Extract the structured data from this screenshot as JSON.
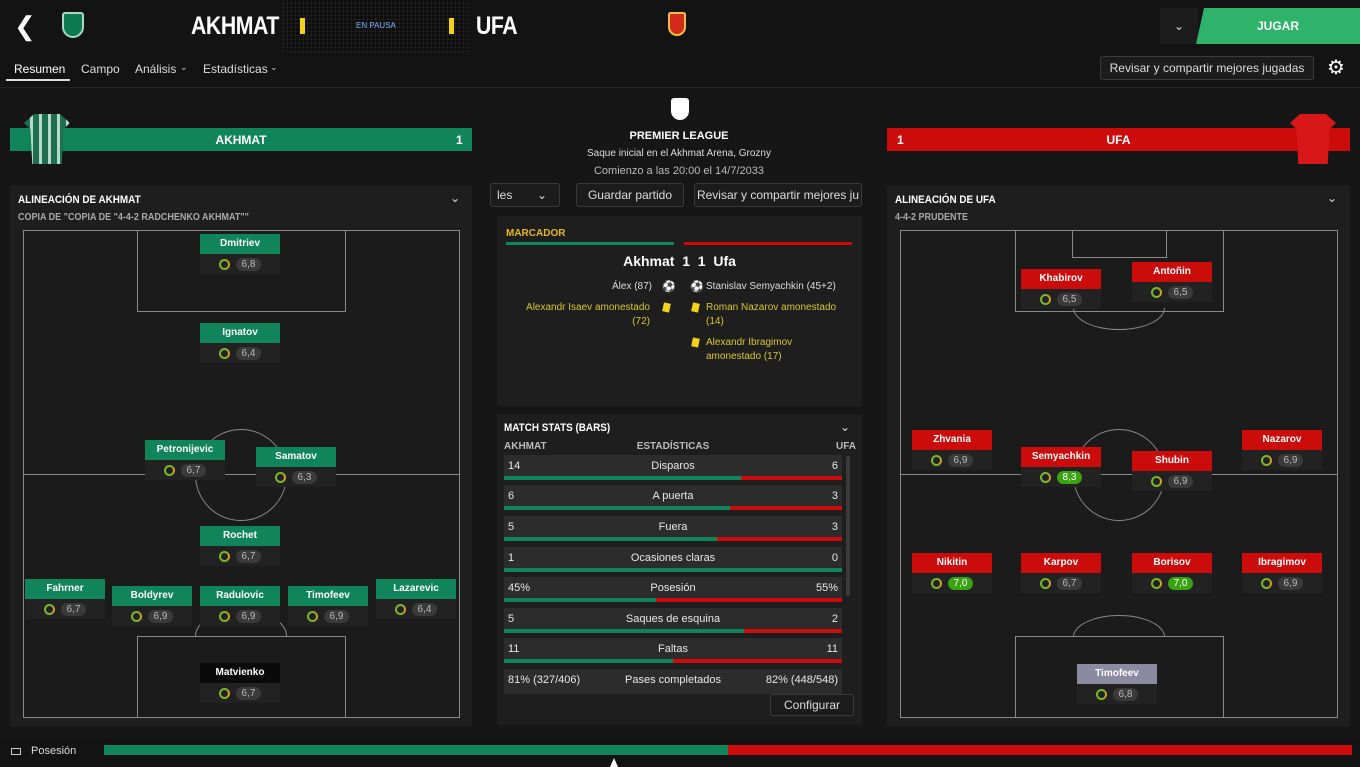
{
  "header": {
    "home_team": "AKHMAT",
    "away_team": "UFA",
    "status": "EN PAUSA",
    "play_label": "JUGAR"
  },
  "tabs": [
    {
      "label": "Resumen"
    },
    {
      "label": "Campo"
    },
    {
      "label": "Análisis"
    },
    {
      "label": "Estadísticas"
    }
  ],
  "review_button": "Revisar y compartir mejores jugadas",
  "home_banner": {
    "name": "AKHMAT",
    "score": "1"
  },
  "away_banner": {
    "name": "UFA",
    "score": "1"
  },
  "match_info": {
    "league": "PREMIER LEAGUE",
    "kickoff": "Saque inicial en el Akhmat Arena, Grozny",
    "time": "Comienzo a las 20:00 el 14/7/2033"
  },
  "mid_buttons": {
    "left": "les",
    "save": "Guardar partido",
    "review": "Revisar y compartir mejores ju"
  },
  "scoreboard": {
    "title": "MARCADOR",
    "line": "Akhmat  1  1  Ufa",
    "home_events": [
      {
        "text": "Álex (87)",
        "type": "goal"
      },
      {
        "text": "Alexandr Isaev amonestado (72)",
        "type": "yellow"
      }
    ],
    "away_events": [
      {
        "text": "Stanislav Semyachkin (45+2)",
        "type": "goal"
      },
      {
        "text": "Roman Nazarov amonestado (14)",
        "type": "yellow"
      },
      {
        "text": "Alexandr Ibragimov amonestado (17)",
        "type": "yellow"
      }
    ]
  },
  "stats": {
    "title": "MATCH STATS (BARS)",
    "home": "AKHMAT",
    "mid": "ESTADÍSTICAS",
    "away": "UFA",
    "configure": "Configurar",
    "rows": [
      {
        "label": "Disparos",
        "home": "14",
        "away": "6",
        "home_share": 0.7
      },
      {
        "label": "A puerta",
        "home": "6",
        "away": "3",
        "home_share": 0.67
      },
      {
        "label": "Fuera",
        "home": "5",
        "away": "3",
        "home_share": 0.63
      },
      {
        "label": "Ocasiones claras",
        "home": "1",
        "away": "0",
        "home_share": 1.0
      },
      {
        "label": "Posesión",
        "home": "45%",
        "away": "55%",
        "home_share": 0.45
      },
      {
        "label": "Saques de esquina",
        "home": "5",
        "away": "2",
        "home_share": 0.71
      },
      {
        "label": "Faltas",
        "home": "11",
        "away": "11",
        "home_share": 0.5
      },
      {
        "label": "Pases completados",
        "home": "81% (327/406)",
        "away": "82% (448/548)",
        "home_share": 0.5
      }
    ]
  },
  "home_lineup": {
    "title": "ALINEACIÓN DE AKHMAT",
    "formation": "COPIA DE \"COPIA DE \"4-4-2 RADCHENKO AKHMAT\"\"",
    "players": [
      {
        "name": "Dmitriev",
        "rating": "6,8"
      },
      {
        "name": "Ignatov",
        "rating": "6,4"
      },
      {
        "name": "Petronijevic",
        "rating": "6,7"
      },
      {
        "name": "Samatov",
        "rating": "6,3"
      },
      {
        "name": "Rochet",
        "rating": "6,7"
      },
      {
        "name": "Fahrner",
        "rating": "6,7"
      },
      {
        "name": "Boldyrev",
        "rating": "6,9"
      },
      {
        "name": "Radulovic",
        "rating": "6,9"
      },
      {
        "name": "Timofeev",
        "rating": "6,9"
      },
      {
        "name": "Lazarevic",
        "rating": "6,4"
      },
      {
        "name": "Matvienko",
        "rating": "6,7"
      }
    ]
  },
  "away_lineup": {
    "title": "ALINEACIÓN DE UFA",
    "formation": "4-4-2 PRUDENTE",
    "players": [
      {
        "name": "Khabirov",
        "rating": "6,5"
      },
      {
        "name": "Antoñin",
        "rating": "6,5"
      },
      {
        "name": "Zhvania",
        "rating": "6,9"
      },
      {
        "name": "Semyachkin",
        "rating": "8,3"
      },
      {
        "name": "Shubin",
        "rating": "6,9"
      },
      {
        "name": "Nazarov",
        "rating": "6,9"
      },
      {
        "name": "Nikitin",
        "rating": "7,0"
      },
      {
        "name": "Karpov",
        "rating": "6,7"
      },
      {
        "name": "Borisov",
        "rating": "7,0"
      },
      {
        "name": "Ibragimov",
        "rating": "6,9"
      },
      {
        "name": "Timofeev",
        "rating": "6,8"
      }
    ]
  },
  "possession_bar": {
    "label": "Posesión",
    "home_share": 0.5
  },
  "colors": {
    "home": "#10845a",
    "away": "#cc0b0b",
    "accent": "#2fb36a"
  }
}
